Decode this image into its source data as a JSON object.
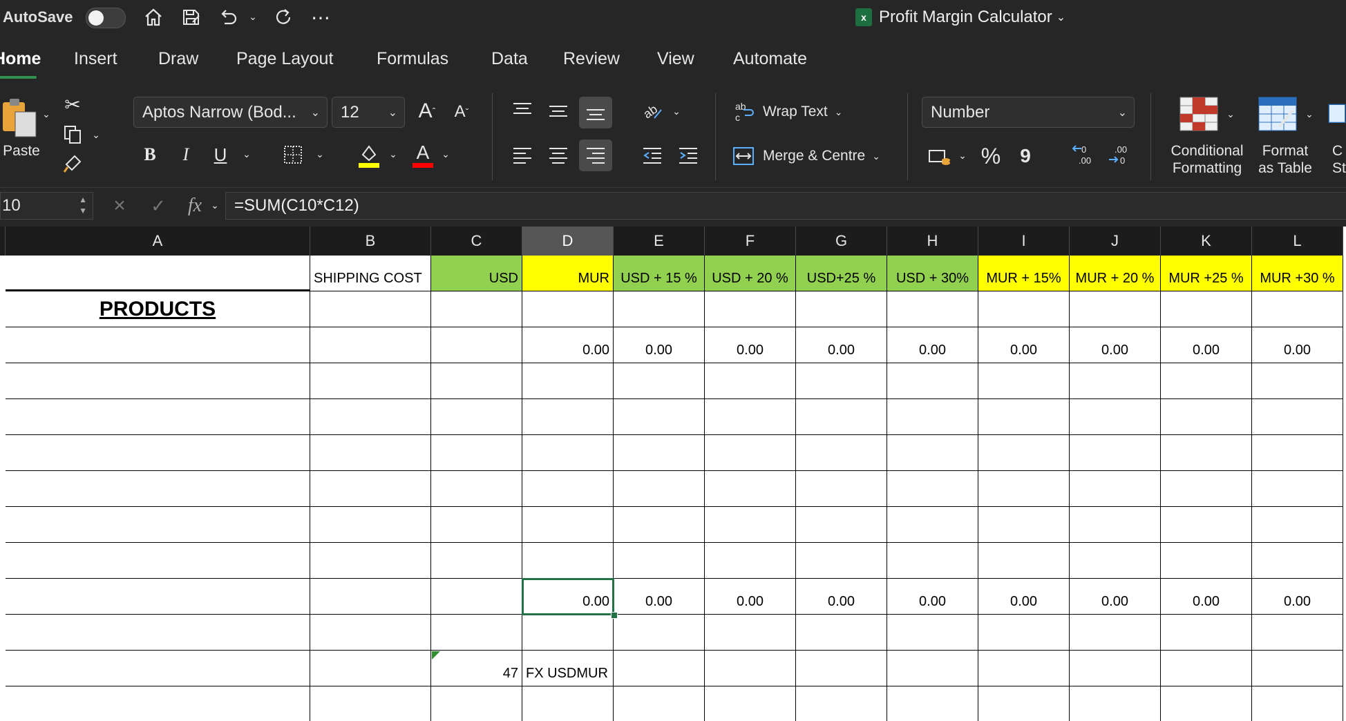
{
  "titlebar": {
    "autosave_label": "AutoSave",
    "title": "Profit Margin Calculator",
    "icons": [
      "home-icon",
      "save-icon",
      "undo-icon",
      "redo-icon",
      "more-icon"
    ]
  },
  "tabs": [
    {
      "label": "Home",
      "active": true
    },
    {
      "label": "Insert"
    },
    {
      "label": "Draw"
    },
    {
      "label": "Page Layout"
    },
    {
      "label": "Formulas"
    },
    {
      "label": "Data"
    },
    {
      "label": "Review"
    },
    {
      "label": "View"
    },
    {
      "label": "Automate"
    }
  ],
  "ribbon": {
    "paste_label": "Paste",
    "font_name": "Aptos Narrow (Bod...",
    "font_size": "12",
    "bold": "B",
    "italic": "I",
    "underline": "U",
    "wrap_text": "Wrap Text",
    "merge_centre": "Merge & Centre",
    "number_format": "Number",
    "percent": "%",
    "comma": "9",
    "conditional_formatting": [
      "Conditional",
      "Formatting"
    ],
    "format_as_table": [
      "Format",
      "as Table"
    ],
    "cell_styles_partial": [
      "C",
      "St"
    ],
    "colors": {
      "highlight": "#ffff00",
      "font_color": "#ff0000"
    }
  },
  "formula_bar": {
    "name_box": "10",
    "formula": "=SUM(C10*C12)"
  },
  "columns": [
    "A",
    "B",
    "C",
    "D",
    "E",
    "F",
    "G",
    "H",
    "I",
    "J",
    "K",
    "L"
  ],
  "selected_column": "D",
  "sheet": {
    "header_row": {
      "B": "SHIPPING COST",
      "C": "USD",
      "D": "MUR",
      "E": "USD + 15 %",
      "F": "USD + 20 %",
      "G": "USD+25 %",
      "H": "USD + 30%",
      "I": "MUR + 15%",
      "J": "MUR + 20 %",
      "K": "MUR +25 %",
      "L": "MUR +30 %"
    },
    "products_label": "PRODUCTS",
    "zero": "0.00",
    "fx_value": "47",
    "fx_label": "FX USDMUR"
  }
}
